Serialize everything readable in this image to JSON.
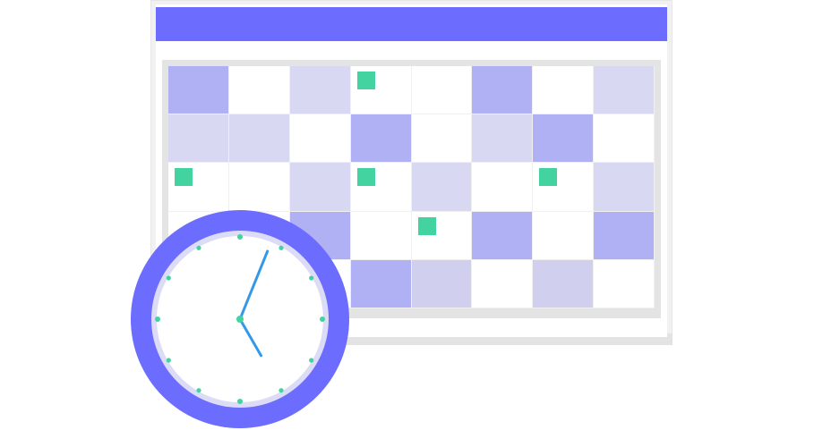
{
  "colors": {
    "header": "#6c6cff",
    "cell_white": "#ffffff",
    "cell_light": "#d8d8f3",
    "cell_medium": "#b0b0f5",
    "cell_grey": "#d0d0ee",
    "event_marker": "#43d3a1",
    "clock_rim": "#6c6cff",
    "clock_rim_inner": "#dcdcf6",
    "clock_face": "#ffffff",
    "clock_hand": "#3498e8",
    "clock_tick": "#43d3a1"
  },
  "icons": {
    "calendar": "calendar-icon",
    "clock": "clock-icon"
  },
  "calendar": {
    "columns": 8,
    "rows": 5,
    "cells": [
      [
        "medium",
        "white",
        "light",
        "white",
        "white",
        "medium",
        "white",
        "light"
      ],
      [
        "light",
        "light",
        "white",
        "medium",
        "white",
        "light",
        "medium",
        "white"
      ],
      [
        "white",
        "white",
        "light",
        "white",
        "light",
        "white",
        "white",
        "light"
      ],
      [
        "white",
        "white",
        "medium",
        "white",
        "white",
        "medium",
        "white",
        "medium"
      ],
      [
        "white",
        "white",
        "white",
        "medium",
        "grey",
        "white",
        "grey",
        "white"
      ]
    ],
    "event_markers": [
      [
        0,
        3
      ],
      [
        2,
        0
      ],
      [
        2,
        3
      ],
      [
        2,
        6
      ],
      [
        3,
        4
      ]
    ]
  },
  "clock": {
    "hour_hand_angle_deg": 150,
    "minute_hand_angle_deg": 22,
    "tick_count": 12
  }
}
